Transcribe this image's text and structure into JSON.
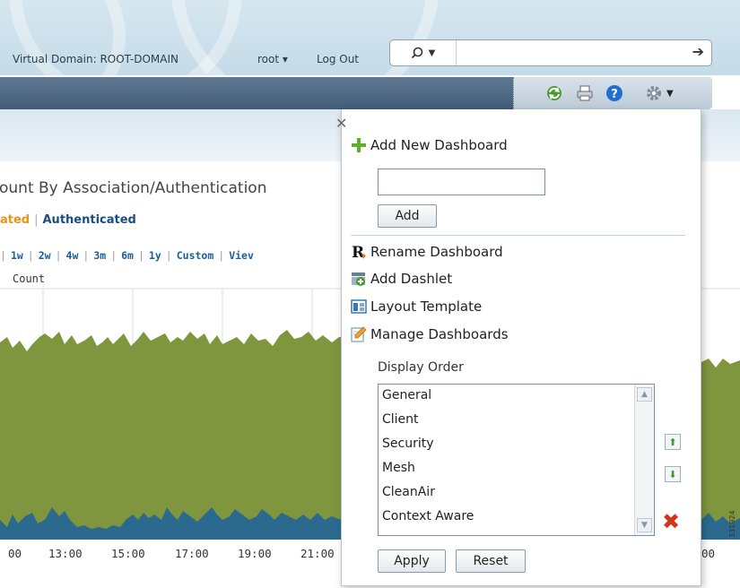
{
  "header": {
    "virtual_domain": "Virtual Domain: ROOT-DOMAIN",
    "user": "root ▾",
    "logout": "Log Out",
    "search": {
      "dropdown_icon": "search-icon",
      "placeholder": "",
      "go_icon": "arrow-right-icon"
    }
  },
  "toolbar": {
    "icons": [
      "refresh-icon",
      "print-icon",
      "help-icon",
      "gear-icon"
    ]
  },
  "dashlet": {
    "title": "Count By Association/Authentication",
    "title_visible": "ount By Association/Authentication",
    "tabs": [
      {
        "label": "ated",
        "color": "#e8931b"
      },
      {
        "label": "Authenticated",
        "color": "#1a4d86"
      }
    ],
    "ranges": [
      "1w",
      "2w",
      "4w",
      "3m",
      "6m",
      "1y",
      "Custom",
      "Viev"
    ],
    "y_label": "Count",
    "x_ticks": [
      "00",
      "13:00",
      "15:00",
      "17:00",
      "19:00",
      "21:00",
      "00"
    ],
    "colors": {
      "associated": "#7f963e",
      "authenticated": "#2b6a8e"
    },
    "figure_id": "331924"
  },
  "popup": {
    "add_new_dashboard": "Add New Dashboard",
    "name_value": "",
    "add_button": "Add",
    "rename_dashboard": "Rename Dashboard",
    "add_dashlet": "Add Dashlet",
    "layout_template": "Layout Template",
    "manage_dashboards": "Manage Dashboards",
    "display_order_label": "Display Order",
    "display_order": [
      "General",
      "Client",
      "Security",
      "Mesh",
      "CleanAir",
      "Context Aware"
    ],
    "apply_button": "Apply",
    "reset_button": "Reset"
  }
}
